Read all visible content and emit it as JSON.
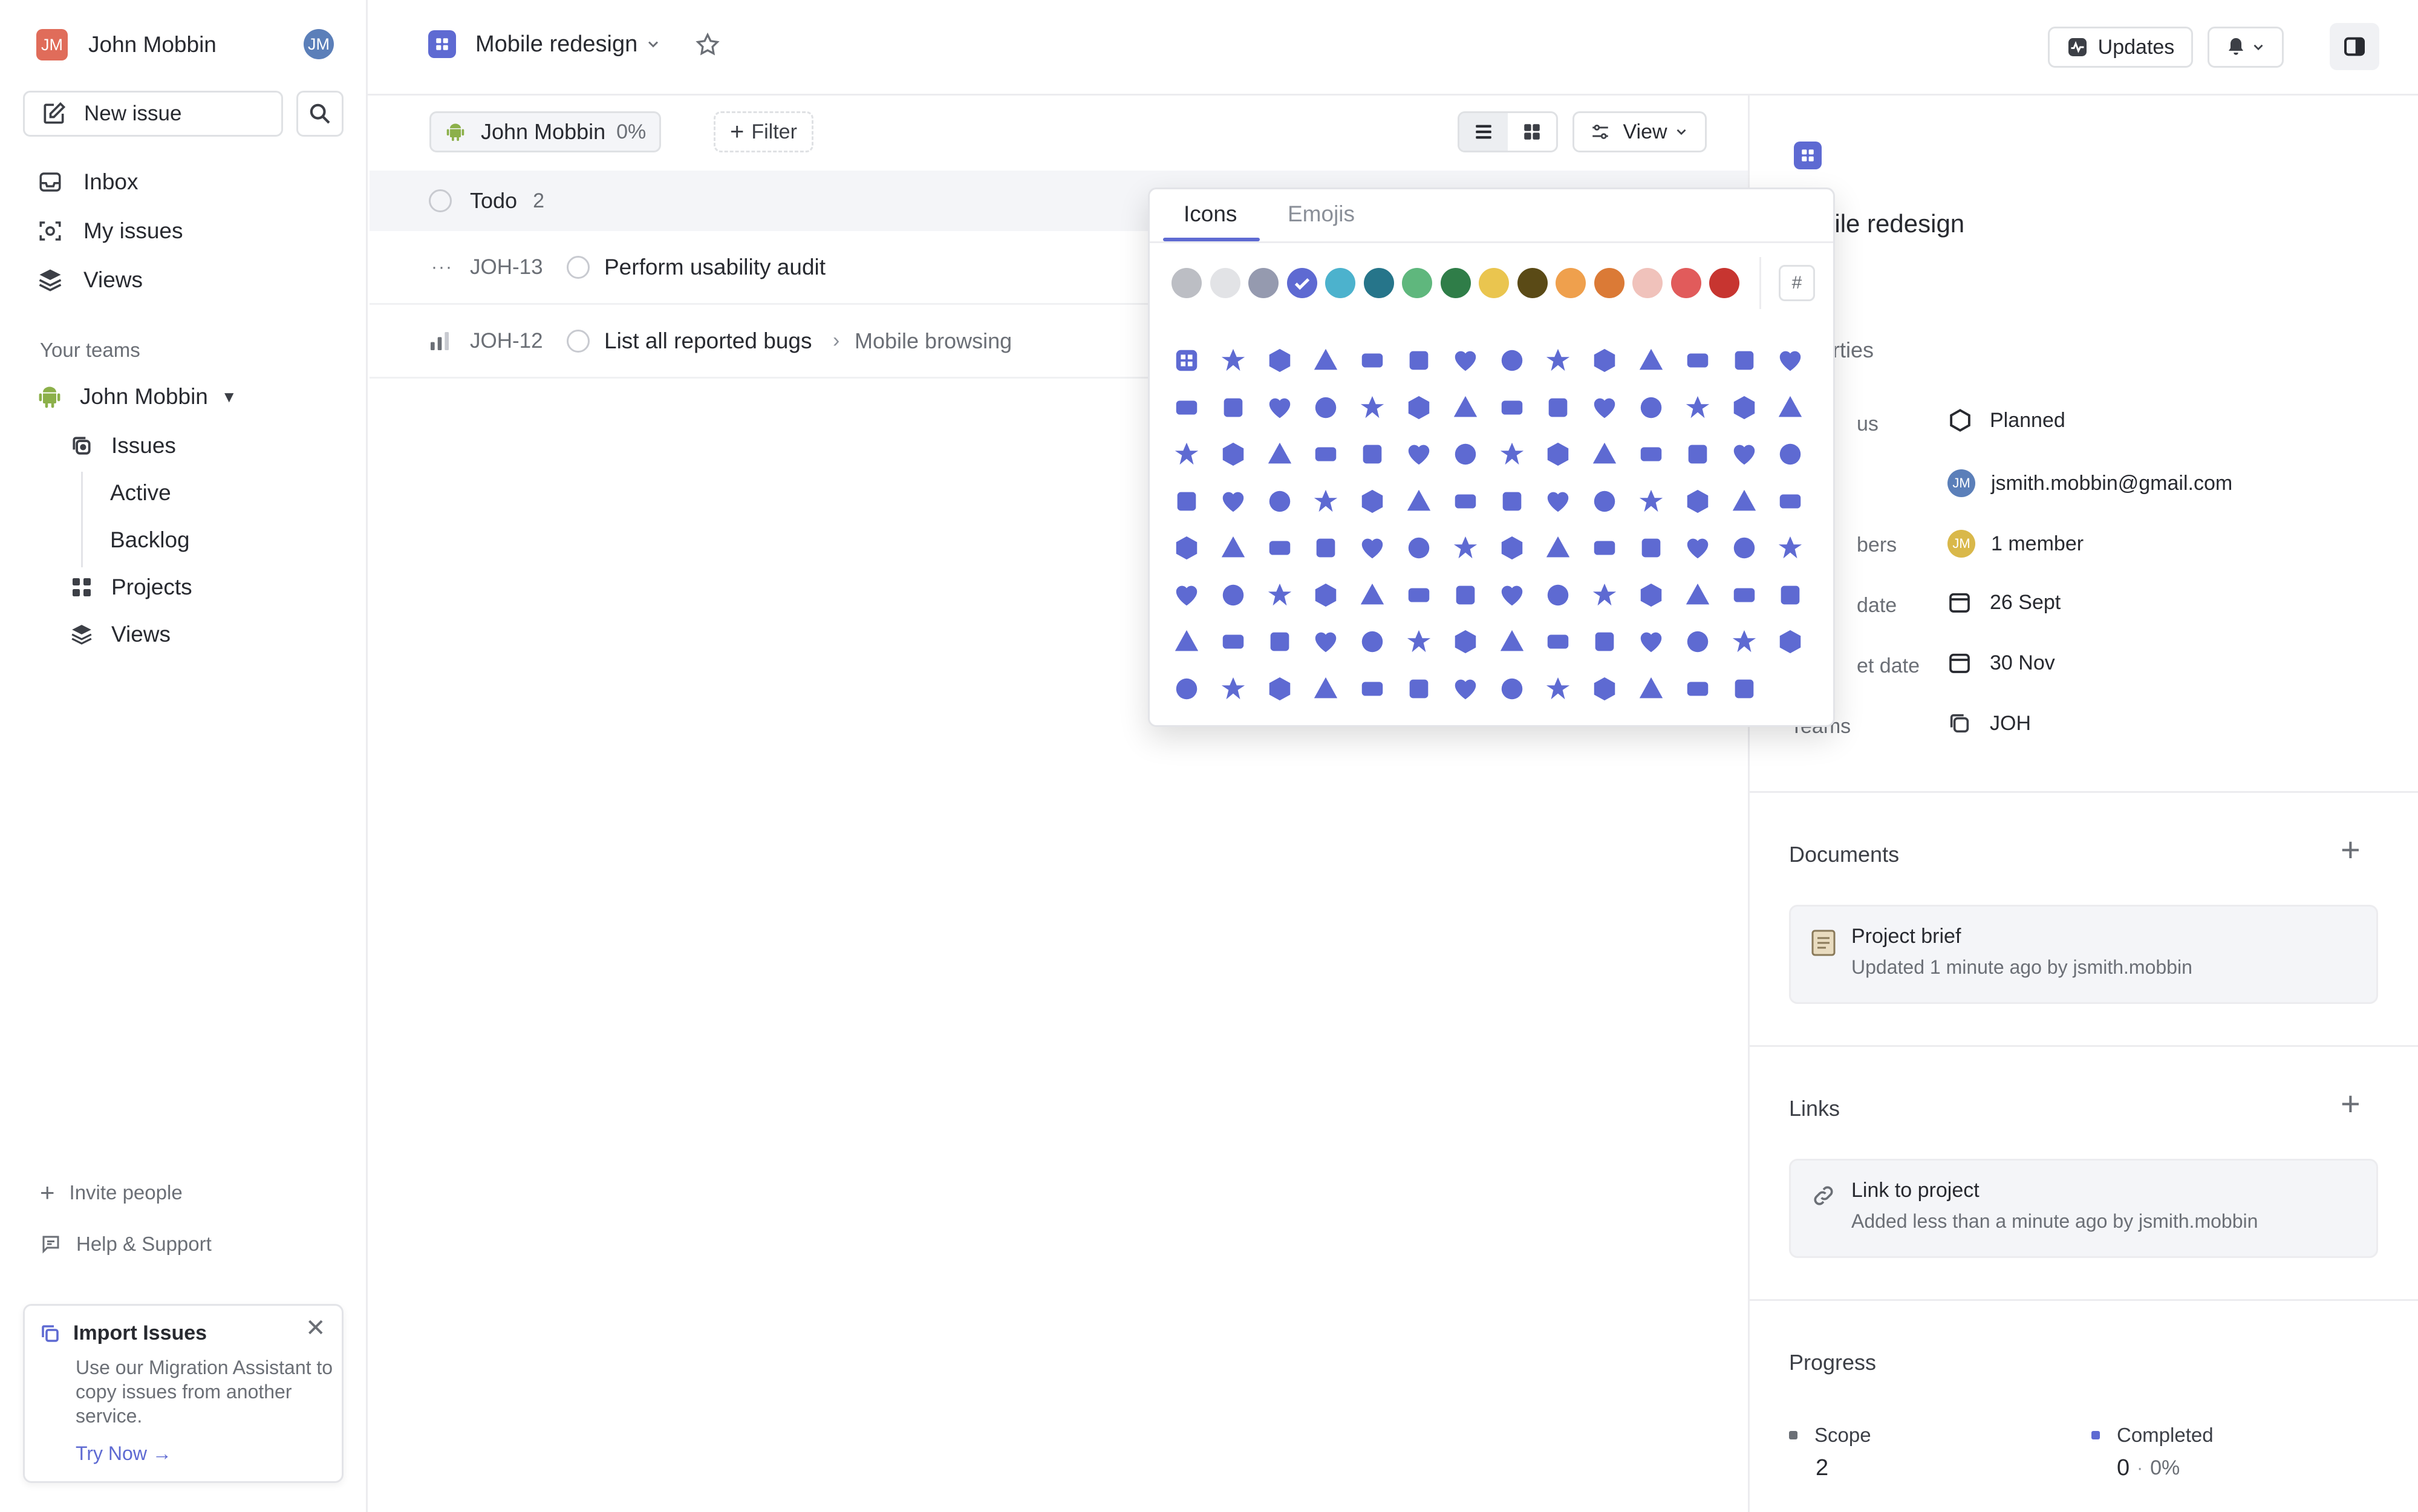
{
  "sidebar": {
    "user": {
      "name": "John Mobbin",
      "initials": "JM"
    },
    "new_issue_label": "New issue",
    "nav": [
      {
        "label": "Inbox",
        "icon": "inbox-icon"
      },
      {
        "label": "My issues",
        "icon": "target-icon"
      },
      {
        "label": "Views",
        "icon": "layers-icon"
      }
    ],
    "your_teams_label": "Your teams",
    "team": {
      "name": "John Mobbin",
      "icon": "android-icon"
    },
    "team_items": [
      {
        "label": "Issues"
      },
      {
        "label": "Active"
      },
      {
        "label": "Backlog"
      },
      {
        "label": "Projects"
      },
      {
        "label": "Views"
      }
    ],
    "invite_label": "Invite people",
    "help_label": "Help & Support",
    "import": {
      "title": "Import Issues",
      "body": "Use our Migration Assistant to copy issues from another service.",
      "cta": "Try Now →"
    }
  },
  "header": {
    "project_name": "Mobile redesign",
    "updates_label": "Updates"
  },
  "toolbar": {
    "team_chip": "John Mobbin",
    "team_chip_percent": "0%",
    "filter_label": "Filter",
    "view_label": "View"
  },
  "group": {
    "label": "Todo",
    "count": "2"
  },
  "issues": [
    {
      "id": "JOH-13",
      "title": "Perform usability audit",
      "extra": ""
    },
    {
      "id": "JOH-12",
      "title": "List all reported bugs",
      "extra": "Mobile browsing"
    }
  ],
  "picker": {
    "tabs": [
      "Icons",
      "Emojis"
    ],
    "active_tab": "Icons",
    "hash_label": "#",
    "colors": [
      "#bcbec4",
      "#e2e3e6",
      "#959aaf",
      "#5e6ad2",
      "#4cb2cd",
      "#26758a",
      "#5fb77d",
      "#2f7d48",
      "#eac54f",
      "#5a4a16",
      "#efa04d",
      "#db7a36",
      "#f0c2bb",
      "#e15b5b",
      "#c73530"
    ],
    "selected_color": "#5e6ad2"
  },
  "panel": {
    "project_title": "bile redesign",
    "properties_label": "erties",
    "props": [
      {
        "label": "us",
        "value": "Planned"
      },
      {
        "label": "",
        "value": "jsmith.mobbin@gmail.com"
      },
      {
        "label": "bers",
        "value": "1 member"
      },
      {
        "label": "date",
        "value": "26 Sept"
      },
      {
        "label": "et date",
        "value": "30 Nov"
      },
      {
        "label": "Teams",
        "value": "JOH"
      }
    ],
    "documents_label": "Documents",
    "document": {
      "title": "Project brief",
      "meta": "Updated 1 minute ago by jsmith.mobbin"
    },
    "links_label": "Links",
    "link": {
      "title": "Link to project",
      "meta": "Added less than a minute ago by jsmith.mobbin"
    },
    "progress_label": "Progress",
    "scope_label": "Scope",
    "scope_value": "2",
    "completed_label": "Completed",
    "completed_value": "0",
    "completed_percent": "0%"
  }
}
